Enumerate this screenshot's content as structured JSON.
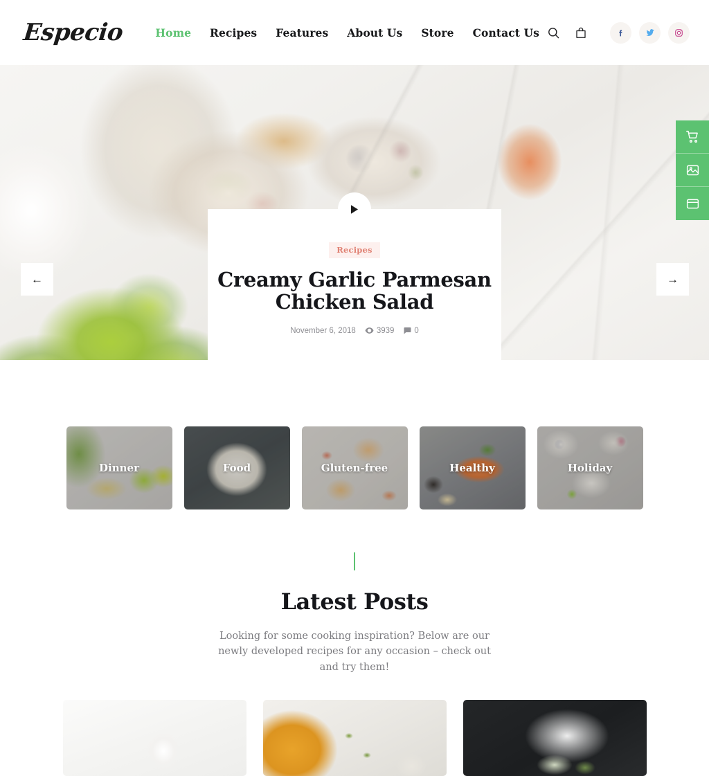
{
  "header": {
    "brand": "Especio",
    "nav": [
      {
        "label": "Home",
        "active": true
      },
      {
        "label": "Recipes",
        "active": false
      },
      {
        "label": "Features",
        "active": false
      },
      {
        "label": "About Us",
        "active": false
      },
      {
        "label": "Store",
        "active": false
      },
      {
        "label": "Contact Us",
        "active": false
      }
    ],
    "tools": {
      "search_icon": "search-icon",
      "cart_icon": "shopping-bag-icon"
    },
    "social": [
      {
        "name": "facebook",
        "glyph": "f",
        "color": "#3b5998"
      },
      {
        "name": "twitter",
        "glyph": "twitter-bird",
        "color": "#55acee"
      },
      {
        "name": "instagram",
        "glyph": "instagram-camera",
        "color": "#c13584"
      }
    ]
  },
  "hero": {
    "prev_label": "←",
    "next_label": "→",
    "play_icon": "play-icon",
    "badge": "Recipes",
    "title": "Creamy Garlic Parmesan Chicken Salad",
    "date": "November 6, 2018",
    "views": "3939",
    "comments": "0",
    "views_icon": "eye-icon",
    "comments_icon": "comment-icon"
  },
  "side_buttons": [
    {
      "name": "cart-icon",
      "label": "cart"
    },
    {
      "name": "gallery-icon",
      "label": "gallery"
    },
    {
      "name": "window-icon",
      "label": "window"
    }
  ],
  "categories": [
    {
      "label": "Dinner",
      "theme": "cat-dinner"
    },
    {
      "label": "Food",
      "theme": "cat-food"
    },
    {
      "label": "Gluten-free",
      "theme": "cat-gluten"
    },
    {
      "label": "Healthy",
      "theme": "cat-healthy"
    },
    {
      "label": "Holiday",
      "theme": "cat-holiday"
    }
  ],
  "latest": {
    "title": "Latest Posts",
    "subtitle": "Looking for some cooking inspiration? Below are our newly developed recipes for any occasion – check out and try them!"
  },
  "posts": [
    {
      "theme": "post-1",
      "alt": "white milk pitcher on white surface"
    },
    {
      "theme": "post-2",
      "alt": "pumpkin soup bowl with seeds"
    },
    {
      "theme": "post-3",
      "alt": "dish on dark slate with white powder"
    }
  ],
  "colors": {
    "accent_green": "#5cc271",
    "badge_bg": "#fdf0ee",
    "badge_text": "#e08274",
    "text_dark": "#15161a",
    "text_muted": "#7c7c80"
  }
}
